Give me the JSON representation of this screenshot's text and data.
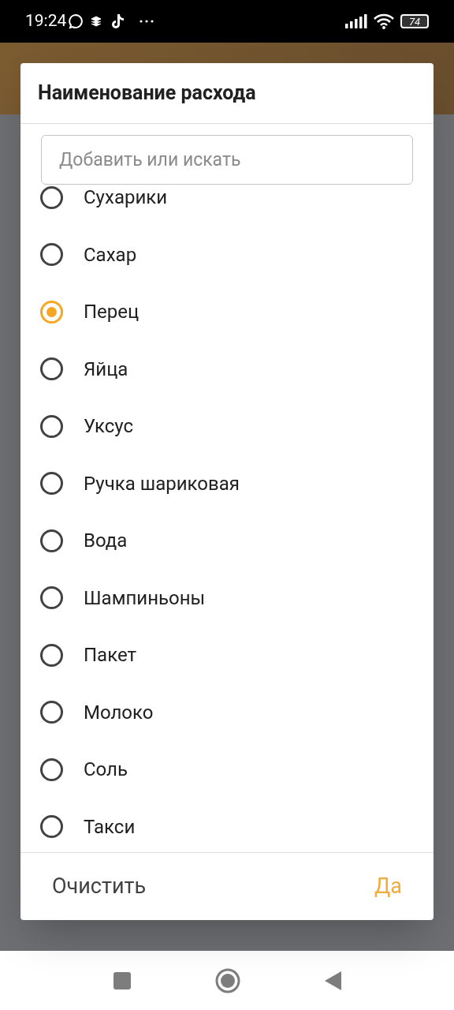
{
  "status_bar": {
    "time": "19:24",
    "battery": "74"
  },
  "dialog": {
    "title": "Наименование расхода",
    "search": {
      "placeholder": "Добавить или искать"
    },
    "options": [
      {
        "label": "Сухарики",
        "selected": false
      },
      {
        "label": "Сахар",
        "selected": false
      },
      {
        "label": "Перец",
        "selected": true
      },
      {
        "label": "Яйца",
        "selected": false
      },
      {
        "label": "Уксус",
        "selected": false
      },
      {
        "label": "Ручка шариковая",
        "selected": false
      },
      {
        "label": "Вода",
        "selected": false
      },
      {
        "label": "Шампиньоны",
        "selected": false
      },
      {
        "label": "Пакет",
        "selected": false
      },
      {
        "label": "Молоко",
        "selected": false
      },
      {
        "label": "Соль",
        "selected": false
      },
      {
        "label": "Такси",
        "selected": false
      }
    ],
    "buttons": [
      {
        "label": "Очистить",
        "kind": "secondary"
      },
      {
        "label": "Да",
        "kind": "primary"
      }
    ]
  }
}
